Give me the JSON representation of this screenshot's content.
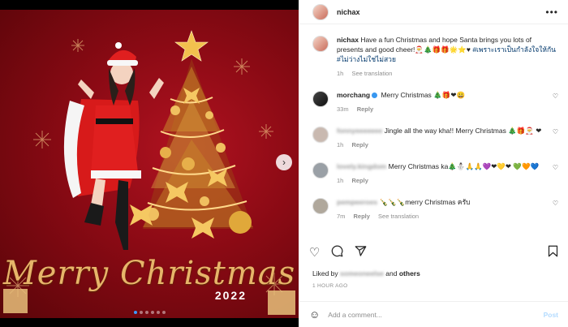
{
  "media": {
    "title_script": "Merry Christmas",
    "year": "2022",
    "carousel_dots": 6,
    "active_dot": 0
  },
  "header": {
    "username": "nichax",
    "more": "•••"
  },
  "caption": {
    "username": "nichax",
    "text": "Have a fun Christmas and hope Santa brings you lots of presents and good cheer!🎅🎄🎁🎁🌟⭐♥",
    "hashtags": "#เพราะเราเป็นกำลังใจให้กัน #ไม่ว่างไม่ใช่ไม่สวย",
    "time": "1h",
    "see_translation": "See translation"
  },
  "comments": [
    {
      "username": "morchang",
      "verified": true,
      "text": "Merry Christmas 🎄🎁❤😀",
      "time": "33m",
      "reply": "Reply",
      "avatar": "dark",
      "blurred": false
    },
    {
      "username": "fonnyeeeeeee",
      "verified": false,
      "text": "Jingle all the way kha!! Merry Christmas 🎄🎁🎅 ❤",
      "time": "1h",
      "reply": "Reply",
      "avatar": "blur1",
      "blurred": true
    },
    {
      "username": "lovely.kingdom",
      "verified": false,
      "text": "Merry Christmas ka🎄⛄🙏🙏💜❤💛❤ 💚🧡💙",
      "time": "1h",
      "reply": "Reply",
      "avatar": "blur2",
      "blurred": true
    },
    {
      "username": "pempeeroes",
      "verified": false,
      "text": "🍾🍾🍾merry Christmas ครับ",
      "time": "7m",
      "reply": "Reply",
      "avatar": "blur3",
      "blurred": true,
      "see_translation": "See translation"
    }
  ],
  "actions": {
    "like": "♡",
    "comment": "💬",
    "share": "➤",
    "save": "🔖"
  },
  "likes": {
    "prefix": "Liked by",
    "user": "someoneelse",
    "suffix": "and",
    "others": "others"
  },
  "timestamp": "1 HOUR AGO",
  "add_comment": {
    "placeholder": "Add a comment...",
    "post": "Post",
    "emoji": "☺"
  },
  "colors": {
    "accent": "#3897f0",
    "post_disabled": "#b3dbff",
    "text": "#262626",
    "muted": "#8e8e8e",
    "background_red": "#8a0a14",
    "gold": "#e7b56a"
  }
}
